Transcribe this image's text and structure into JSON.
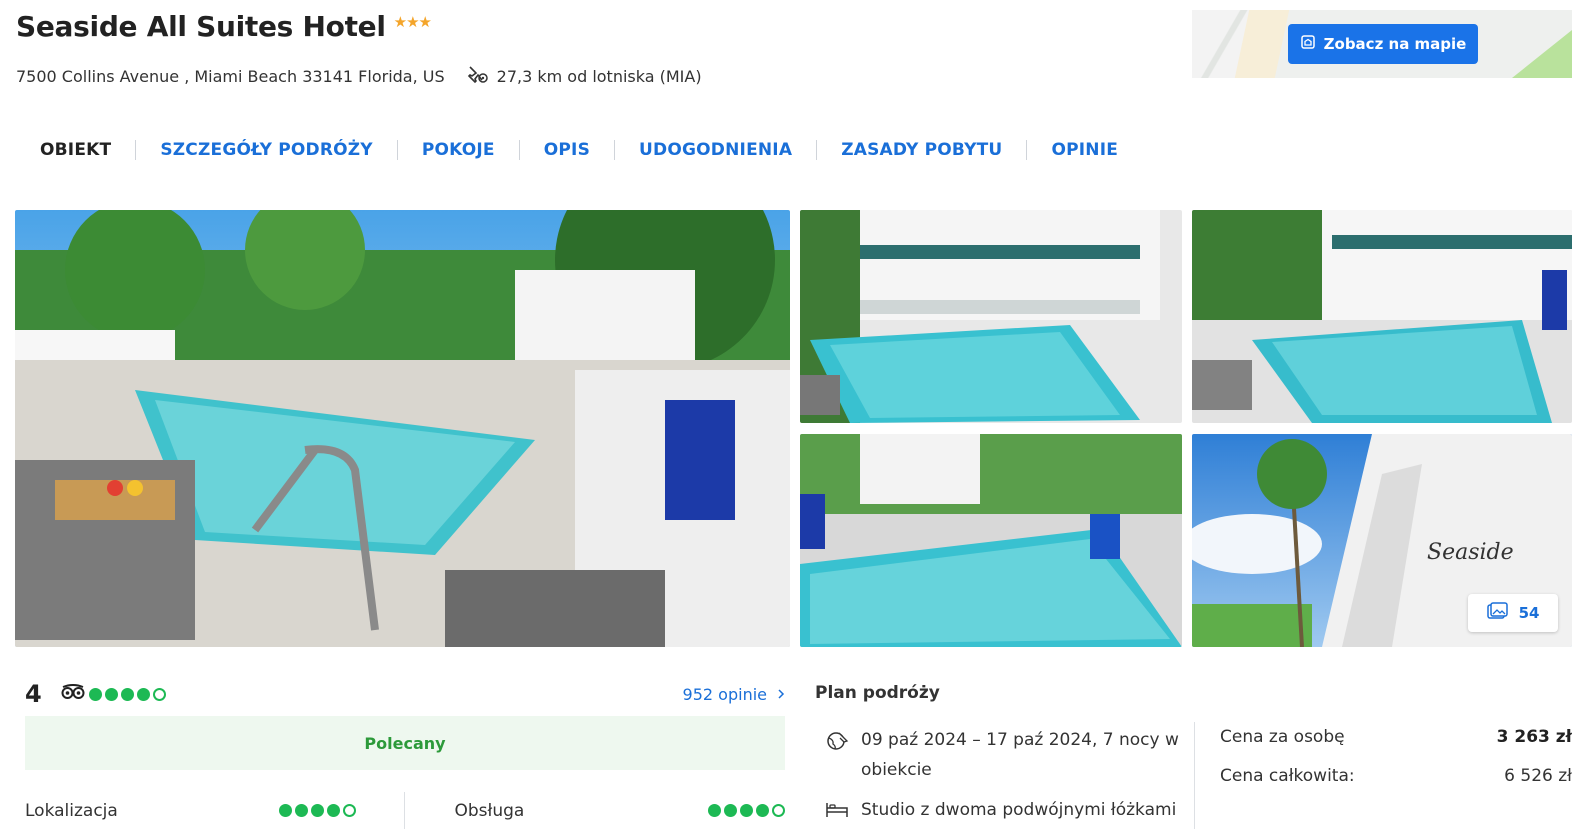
{
  "hotel": {
    "name": "Seaside All Suites Hotel",
    "stars": "★★★",
    "address": "7500 Collins Avenue , Miami Beach 33141 Florida, US",
    "airport_distance": "27,3 km od lotniska (MIA)"
  },
  "map": {
    "button_label": "Zobacz na mapie"
  },
  "tabs": [
    "OBIEKT",
    "SZCZEGÓŁY PODRÓŻY",
    "POKOJE",
    "OPIS",
    "UDOGODNIENIA",
    "ZASADY POBYTU",
    "OPINIE"
  ],
  "gallery": {
    "photo_count": "54"
  },
  "rating": {
    "score": "4",
    "reviews_link": "952 opinie",
    "recommend_label": "Polecany",
    "sub": [
      {
        "label": "Lokalizacja",
        "filled": 4
      },
      {
        "label": "Obsługa",
        "filled": 4
      }
    ],
    "filled": 4
  },
  "plan": {
    "title": "Plan podróży",
    "dates": "09 paź 2024 – 17 paź 2024, 7 nocy w obiekcie",
    "room": "Studio z dwoma podwójnymi łóżkami"
  },
  "prices": {
    "per_person_label": "Cena za osobę",
    "per_person_value": "3 263 zł",
    "total_label": "Cena całkowita:",
    "total_value": "6 526 zł"
  },
  "colors": {
    "accent": "#1a73e8",
    "link": "#1a6fd8",
    "rating_green": "#1db954",
    "star": "#f4a52b"
  }
}
